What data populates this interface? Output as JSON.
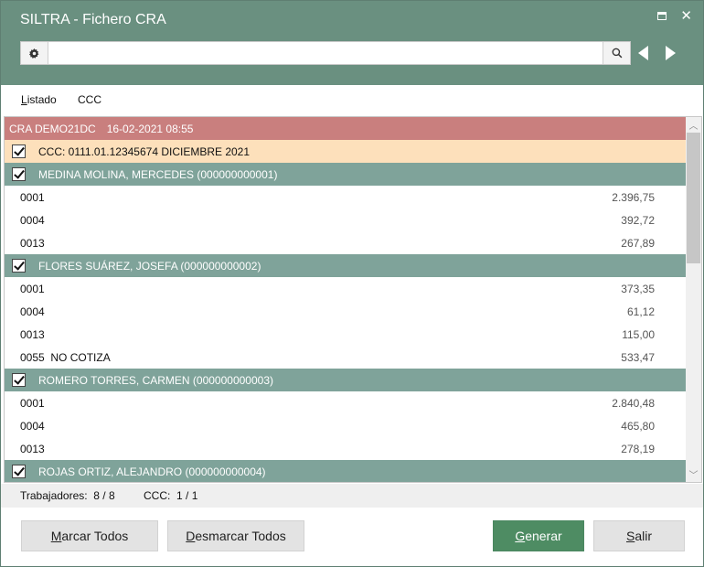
{
  "window": {
    "title": "SILTRA - Fichero CRA",
    "maximize_icon": "maximize-icon",
    "close_symbol": "✕"
  },
  "search": {
    "value": "",
    "placeholder": "",
    "settings_icon": "gear-icon",
    "search_icon": "search-icon",
    "prev_icon": "triangle-left-icon",
    "next_icon": "triangle-right-icon"
  },
  "tabs": {
    "listado_first": "L",
    "listado_rest": "istado",
    "ccc": "CCC"
  },
  "list": {
    "header": {
      "name": "CRA DEMO21DC",
      "datetime": "16-02-2021 08:55"
    },
    "ccc_row": "CCC: 0111.01.12345674 DICIEMBRE 2021",
    "workers": [
      {
        "name": "MEDINA MOLINA, MERCEDES (000000000001)",
        "checked": true,
        "items": [
          {
            "code": "0001",
            "amount": "2.396,75"
          },
          {
            "code": "0004",
            "amount": "392,72"
          },
          {
            "code": "0013",
            "amount": "267,89"
          }
        ]
      },
      {
        "name": "FLORES SUÁREZ, JOSEFA (000000000002)",
        "checked": true,
        "items": [
          {
            "code": "0001",
            "amount": "373,35"
          },
          {
            "code": "0004",
            "amount": "61,12"
          },
          {
            "code": "0013",
            "amount": "115,00"
          },
          {
            "code": "0055  NO COTIZA",
            "amount": "533,47"
          }
        ]
      },
      {
        "name": "ROMERO TORRES, CARMEN (000000000003)",
        "checked": true,
        "items": [
          {
            "code": "0001",
            "amount": "2.840,48"
          },
          {
            "code": "0004",
            "amount": "465,80"
          },
          {
            "code": "0013",
            "amount": "278,19"
          }
        ]
      },
      {
        "name": "ROJAS ORTIZ, ALEJANDRO (000000000004)",
        "checked": true,
        "items": []
      }
    ],
    "scroll_up": "︿",
    "scroll_down": "﹀"
  },
  "status": {
    "workers_label": "Trabajadores:",
    "workers_value": "8 / 8",
    "ccc_label": "CCC:",
    "ccc_value": "1 / 1"
  },
  "buttons": {
    "marcar": "Marcar Todos",
    "desmarcar": "Desmarcar Todos",
    "generar": "Generar",
    "salir": "Salir"
  },
  "colors": {
    "titlebar": "#6a9080",
    "header_row": "#c97f7e",
    "ccc_row": "#fde0bb",
    "worker_row": "#7fa39a",
    "primary_button": "#4e8c63"
  }
}
